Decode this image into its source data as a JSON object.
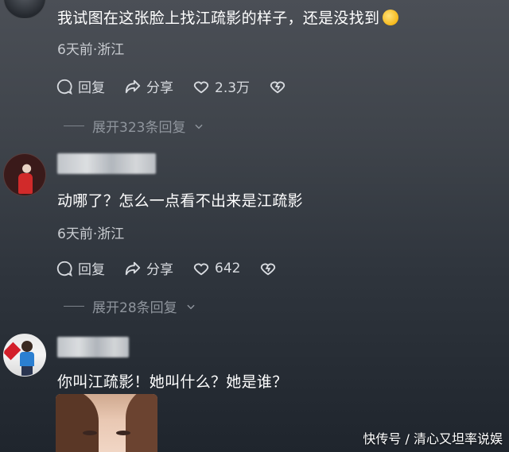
{
  "comments": [
    {
      "text": "我试图在这张脸上找江疏影的样子，还是没找到",
      "emoji": "laughing-crying-emoji",
      "meta": "6天前·浙江",
      "reply_label": "回复",
      "share_label": "分享",
      "like_count": "2.3万",
      "expand_label": "展开323条回复"
    },
    {
      "text": "动哪了？怎么一点看不出来是江疏影",
      "meta": "6天前·浙江",
      "reply_label": "回复",
      "share_label": "分享",
      "like_count": "642",
      "expand_label": "展开28条回复"
    },
    {
      "text": "你叫江疏影！她叫什么？她是谁？"
    }
  ],
  "watermark": "快传号 / 清心又坦率说娱",
  "colors": {
    "text_primary": "#ffffff",
    "text_meta": "#c9ccd1",
    "text_expand": "#8f959d"
  }
}
